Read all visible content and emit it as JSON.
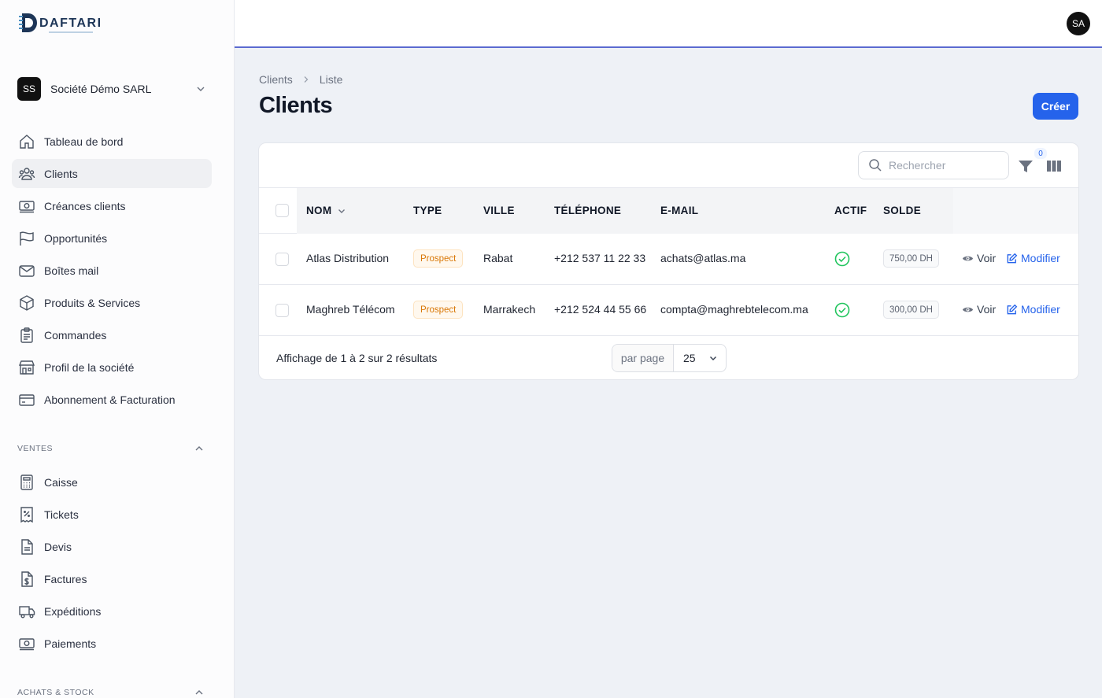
{
  "app": {
    "logo_text": "DAFTARI"
  },
  "company": {
    "initials": "SS",
    "name": "Société Démo SARL"
  },
  "user": {
    "initials": "SA"
  },
  "sidebar": {
    "items": [
      {
        "label": "Tableau de bord",
        "icon": "home-icon"
      },
      {
        "label": "Clients",
        "icon": "users-icon",
        "active": true
      },
      {
        "label": "Créances clients",
        "icon": "money-icon"
      },
      {
        "label": "Opportunités",
        "icon": "flag-icon"
      },
      {
        "label": "Boîtes mail",
        "icon": "mail-icon"
      },
      {
        "label": "Produits & Services",
        "icon": "cube-icon"
      },
      {
        "label": "Commandes",
        "icon": "clipboard-icon"
      },
      {
        "label": "Profil de la société",
        "icon": "store-icon"
      },
      {
        "label": "Abonnement & Facturation",
        "icon": "credit-card-icon"
      }
    ],
    "sections": [
      {
        "label": "VENTES",
        "items": [
          {
            "label": "Caisse",
            "icon": "calculator-icon"
          },
          {
            "label": "Tickets",
            "icon": "receipt-icon"
          },
          {
            "label": "Devis",
            "icon": "document-icon"
          },
          {
            "label": "Factures",
            "icon": "invoice-icon"
          },
          {
            "label": "Expéditions",
            "icon": "truck-icon"
          },
          {
            "label": "Paiements",
            "icon": "cash-icon"
          }
        ]
      },
      {
        "label": "ACHATS & STOCK",
        "items": []
      }
    ]
  },
  "breadcrumb": {
    "root": "Clients",
    "current": "Liste"
  },
  "page": {
    "title": "Clients",
    "create_label": "Créer"
  },
  "toolbar": {
    "search_placeholder": "Rechercher",
    "filter_count": "0"
  },
  "table": {
    "headers": {
      "name": "NOM",
      "type": "TYPE",
      "city": "VILLE",
      "phone": "TÉLÉPHONE",
      "email": "E-MAIL",
      "active": "ACTIF",
      "balance": "SOLDE"
    },
    "rows": [
      {
        "name": "Atlas Distribution",
        "type": "Prospect",
        "city": "Rabat",
        "phone": "+212 537 11 22 33",
        "email": "achats@atlas.ma",
        "active": true,
        "balance": "750,00 DH",
        "view": "Voir",
        "edit": "Modifier"
      },
      {
        "name": "Maghreb Télécom",
        "type": "Prospect",
        "city": "Marrakech",
        "phone": "+212 524 44 55 66",
        "email": "compta@maghrebtelecom.ma",
        "active": true,
        "balance": "300,00 DH",
        "view": "Voir",
        "edit": "Modifier"
      }
    ]
  },
  "footer": {
    "summary": "Affichage de 1 à 2 sur 2 résultats",
    "per_page_label": "par page",
    "per_page_value": "25"
  },
  "colors": {
    "primary": "#2563eb",
    "accent_line": "#5b6ad0",
    "success": "#22c55e",
    "prospect": "#d97706"
  }
}
